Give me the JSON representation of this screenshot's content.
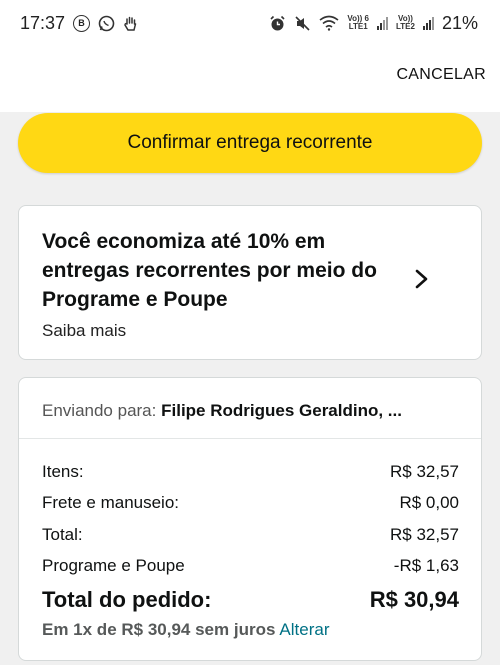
{
  "status_bar": {
    "time": "17:37",
    "left_icons": [
      "b-circle-icon",
      "whatsapp-icon",
      "hand-icon"
    ],
    "sim1": {
      "top": "Vo)) 6",
      "bottom": "LTE1"
    },
    "sim2": {
      "top": "Vo))",
      "bottom": "LTE2"
    },
    "battery": "21%"
  },
  "header": {
    "cancel_label": "CANCELAR"
  },
  "confirm_button": {
    "label": "Confirmar entrega recorrente",
    "color": "#ffd814"
  },
  "promo": {
    "title": "Você economiza até 10% em entregas recorrentes por meio do Programe e Poupe",
    "link": "Saiba mais"
  },
  "summary": {
    "ship_label": "Enviando para:",
    "ship_name": "Filipe Rodrigues Geraldino, ...",
    "rows": [
      {
        "label": "Itens:",
        "value": "R$ 32,57"
      },
      {
        "label": "Frete e manuseio:",
        "value": "R$ 0,00"
      },
      {
        "label": "Total:",
        "value": "R$ 32,57"
      },
      {
        "label": "Programe e Poupe",
        "value": "-R$ 1,63"
      }
    ],
    "order_total_label": "Total do pedido:",
    "order_total_value": "R$ 30,94",
    "installment_text": "Em 1x de R$ 30,94 sem juros",
    "change_label": "Alterar",
    "link_color": "#007185"
  }
}
